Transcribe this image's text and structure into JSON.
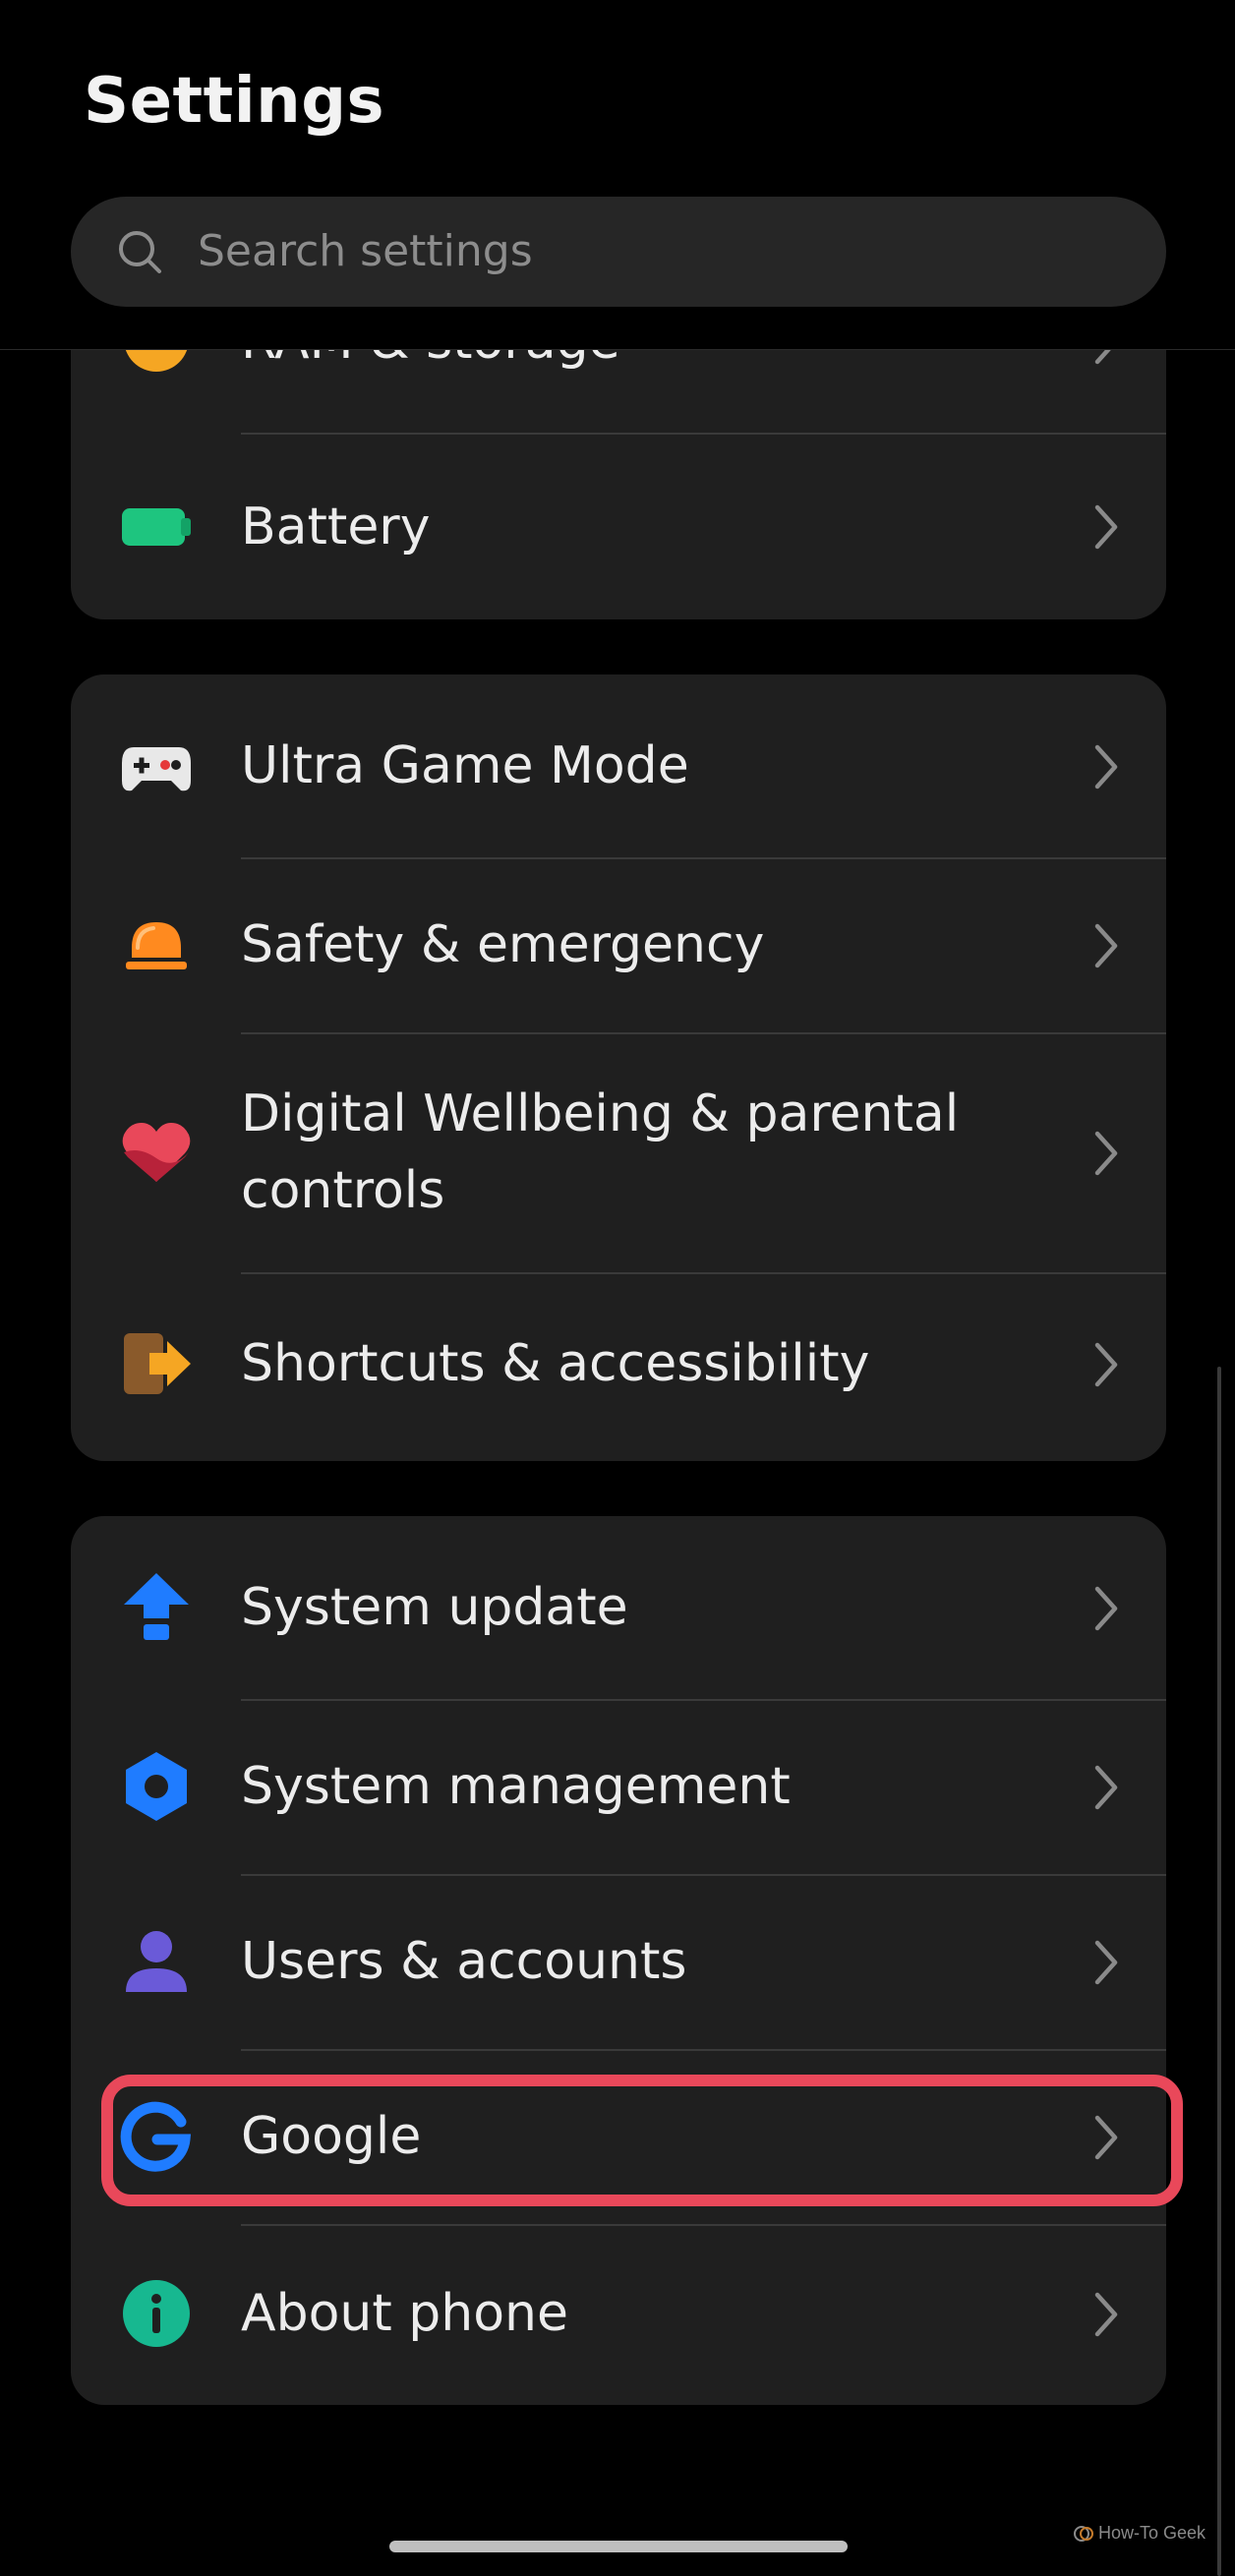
{
  "header": {
    "title": "Settings",
    "search_placeholder": "Search settings"
  },
  "cards": [
    {
      "items": [
        {
          "label": "RAM & storage",
          "icon": "storage-icon",
          "partially_visible": true
        },
        {
          "label": "Battery",
          "icon": "battery-icon"
        }
      ]
    },
    {
      "items": [
        {
          "label": "Ultra Game Mode",
          "icon": "gamepad-icon"
        },
        {
          "label": "Safety & emergency",
          "icon": "emergency-light-icon"
        },
        {
          "label": "Digital Wellbeing & parental controls",
          "icon": "heart-icon"
        },
        {
          "label": "Shortcuts & accessibility",
          "icon": "shortcut-icon"
        }
      ]
    },
    {
      "items": [
        {
          "label": "System update",
          "icon": "update-arrow-icon"
        },
        {
          "label": "System management",
          "icon": "hexagon-gear-icon"
        },
        {
          "label": "Users & accounts",
          "icon": "person-icon"
        },
        {
          "label": "Google",
          "icon": "google-icon",
          "highlighted": true
        },
        {
          "label": "About phone",
          "icon": "info-icon"
        }
      ]
    }
  ],
  "colors": {
    "background": "#000000",
    "card": "#1f1f1f",
    "highlight": "#e9485a",
    "battery": "#1ec57f",
    "game_accent": "#e5393a",
    "emergency": "#ff8a1f",
    "wellbeing": "#e9485a",
    "shortcut": "#f5a623",
    "system_blue": "#1f7cff",
    "users": "#6a5ad8",
    "about": "#17b890"
  },
  "watermark": "How-To Geek"
}
